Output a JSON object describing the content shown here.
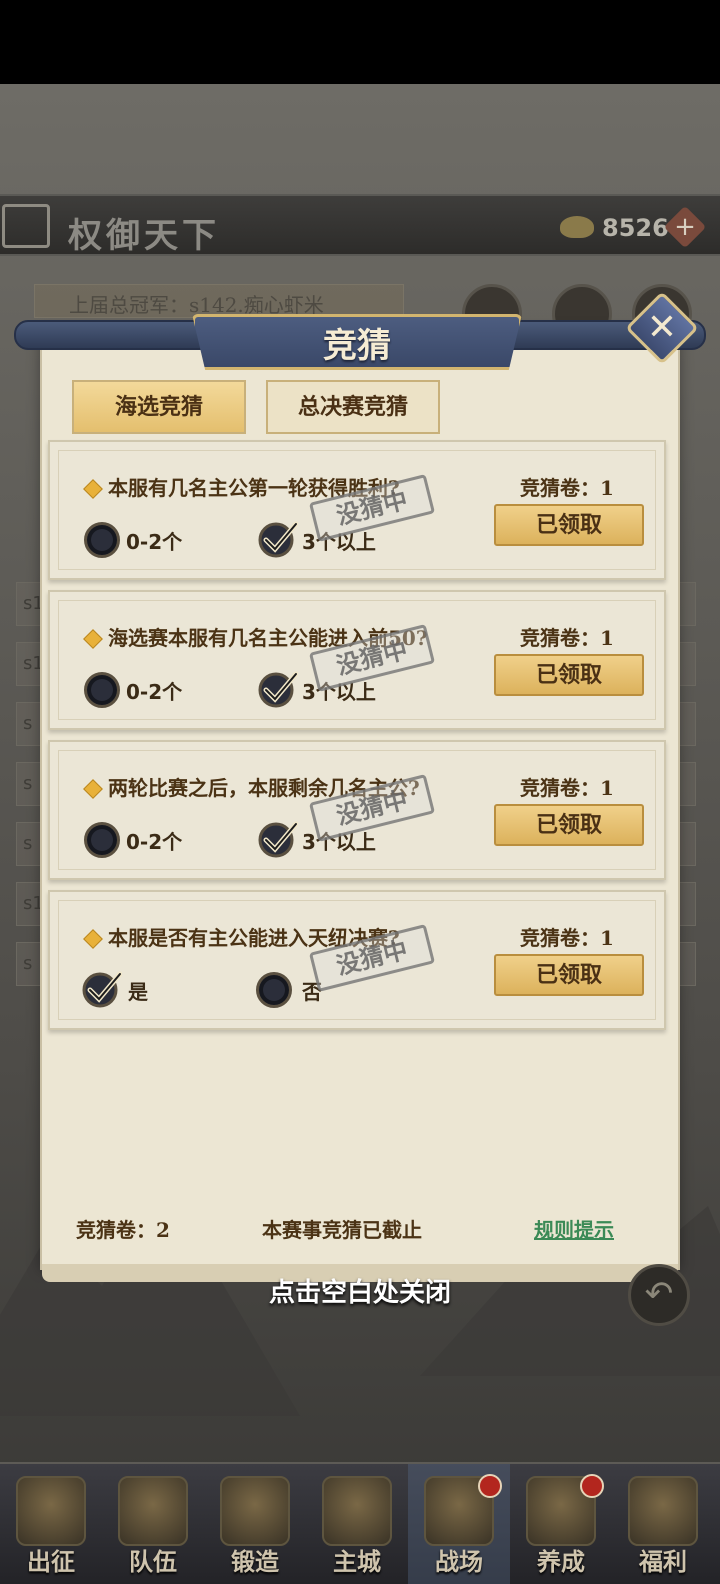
{
  "header": {
    "title": "权御天下",
    "currency_value": "8526",
    "champion_text": "上届总冠军：s142.痴心虾米"
  },
  "background_rows": [
    "s1",
    "s1",
    "s",
    "s",
    "s",
    "s1",
    "s"
  ],
  "modal": {
    "title": "竞猜",
    "close_label": "✕",
    "tabs": [
      {
        "label": "海选竞猜",
        "active": true
      },
      {
        "label": "总决赛竞猜",
        "active": false
      }
    ],
    "questions": [
      {
        "text": "本服有几名主公第一轮获得胜利?",
        "ticket": "竞猜卷：1",
        "button": "已领取",
        "stamp": "没猜中",
        "options": [
          {
            "label": "0-2个",
            "checked": false
          },
          {
            "label": "3个以上",
            "checked": true
          }
        ]
      },
      {
        "text": "海选赛本服有几名主公能进入前50?",
        "ticket": "竞猜卷：1",
        "button": "已领取",
        "stamp": "没猜中",
        "options": [
          {
            "label": "0-2个",
            "checked": false
          },
          {
            "label": "3个以上",
            "checked": true
          }
        ]
      },
      {
        "text": "两轮比赛之后，本服剩余几名主公?",
        "ticket": "竞猜卷：1",
        "button": "已领取",
        "stamp": "没猜中",
        "options": [
          {
            "label": "0-2个",
            "checked": false
          },
          {
            "label": "3个以上",
            "checked": true
          }
        ]
      },
      {
        "text": "本服是否有主公能进入天纽决赛?",
        "ticket": "竞猜卷：1",
        "button": "已领取",
        "stamp": "没猜中",
        "options": [
          {
            "label": "是",
            "checked": true
          },
          {
            "label": "否",
            "checked": false
          }
        ]
      }
    ],
    "footer": {
      "ticket_total": "竞猜卷：2",
      "status": "本赛事竞猜已截止",
      "rules_link": "规则提示"
    },
    "close_hint": "点击空白处关闭"
  },
  "bottom_nav": [
    {
      "label": "出征",
      "icon": "crossed-swords-icon",
      "badge": false,
      "active": false
    },
    {
      "label": "队伍",
      "icon": "warrior-icon",
      "badge": false,
      "active": false
    },
    {
      "label": "锻造",
      "icon": "anvil-icon",
      "badge": false,
      "active": false
    },
    {
      "label": "主城",
      "icon": "palace-icon",
      "badge": false,
      "active": false
    },
    {
      "label": "战场",
      "icon": "battlefield-icon",
      "badge": true,
      "active": true
    },
    {
      "label": "养成",
      "icon": "cauldron-icon",
      "badge": true,
      "active": false
    },
    {
      "label": "福利",
      "icon": "gift-building-icon",
      "badge": false,
      "active": false
    }
  ]
}
